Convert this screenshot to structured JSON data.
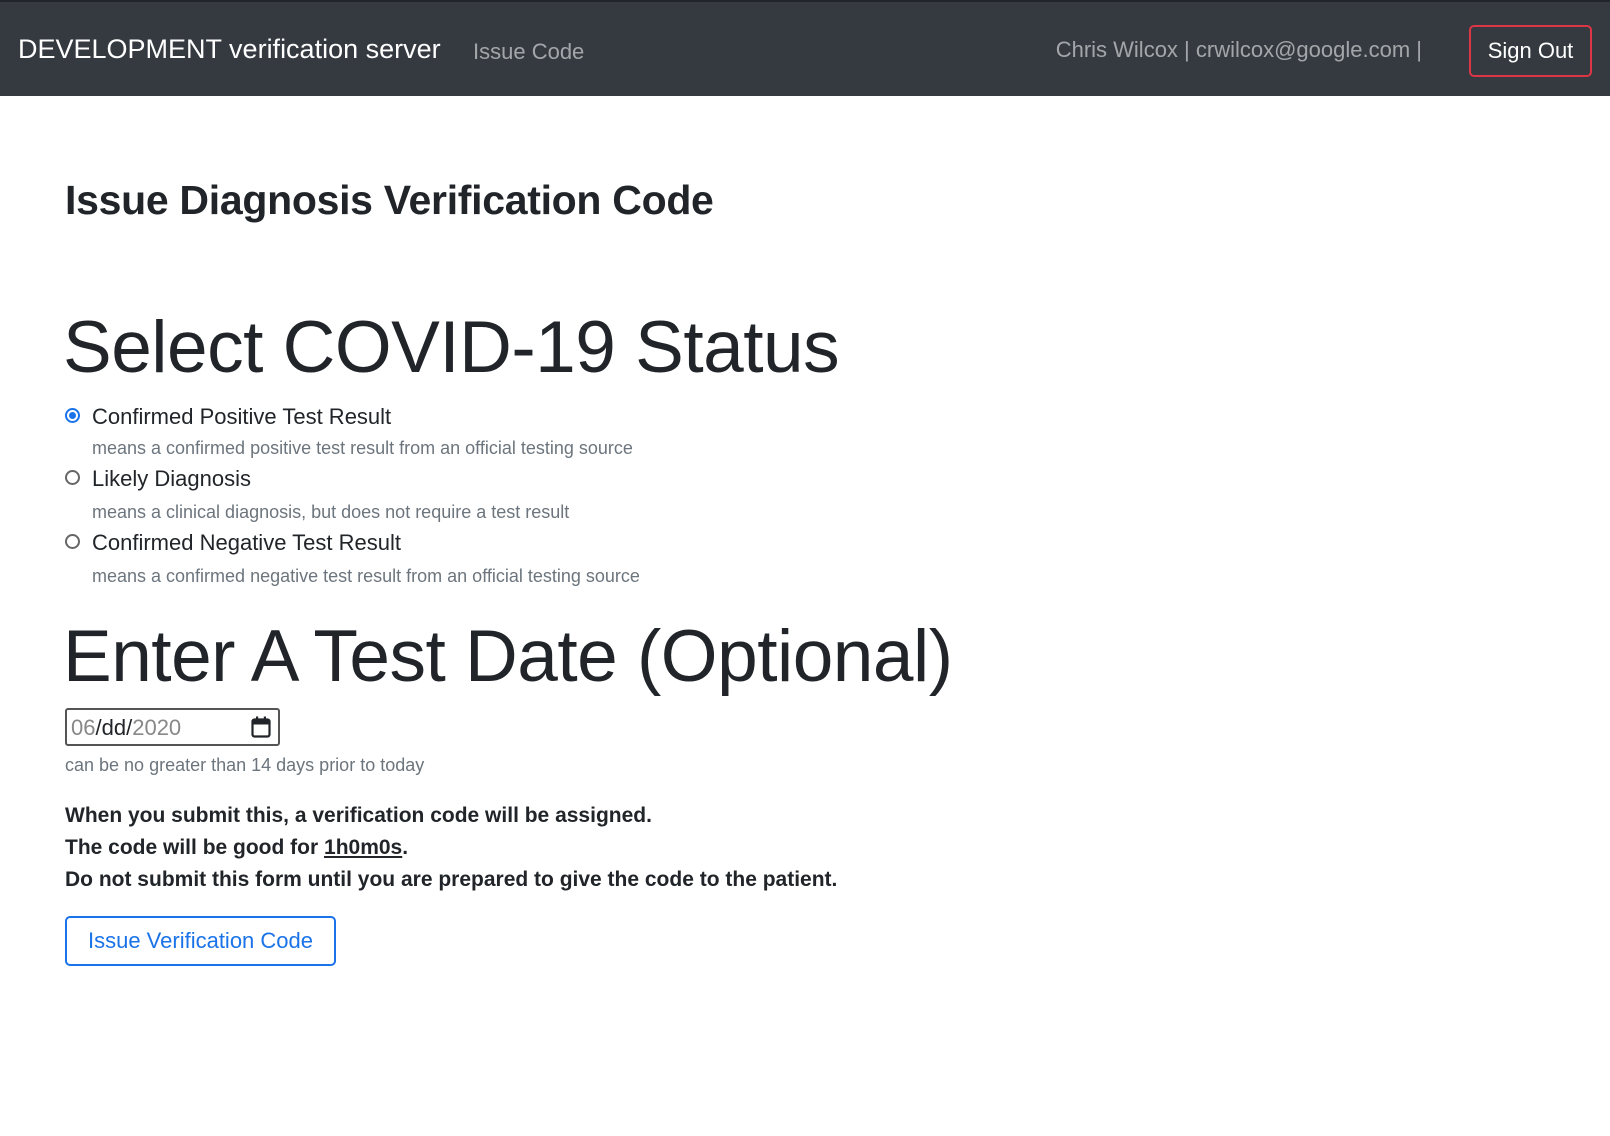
{
  "navbar": {
    "brand": "DEVELOPMENT verification server",
    "nav_link": "Issue Code",
    "user_info": "Chris Wilcox | crwilcox@google.com |",
    "signout_label": "Sign Out"
  },
  "page": {
    "title": "Issue Diagnosis Verification Code"
  },
  "status_section": {
    "heading": "Select COVID-19 Status",
    "options": [
      {
        "label": "Confirmed Positive Test Result",
        "help": "means a confirmed positive test result from an official testing source",
        "checked": true
      },
      {
        "label": "Likely Diagnosis",
        "help": "means a clinical diagnosis, but does not require a test result",
        "checked": false
      },
      {
        "label": "Confirmed Negative Test Result",
        "help": "means a confirmed negative test result from an official testing source",
        "checked": false
      }
    ]
  },
  "date_section": {
    "heading": "Enter A Test Date (Optional)",
    "month": "06",
    "day": "dd",
    "year": "2020",
    "separator": "/",
    "help": "can be no greater than 14 days prior to today",
    "icon": "calendar-icon"
  },
  "notice": {
    "line1": "When you submit this, a verification code will be assigned.",
    "line2_prefix": "The code will be good for ",
    "duration": "1h0m0s",
    "line2_suffix": ".",
    "line3": "Do not submit this form until you are prepared to give the code to the patient."
  },
  "submit": {
    "label": "Issue Verification Code"
  },
  "colors": {
    "navbar_bg": "#343a40",
    "accent": "#1a73e8",
    "danger": "#dc3545",
    "muted": "#6c757d"
  }
}
